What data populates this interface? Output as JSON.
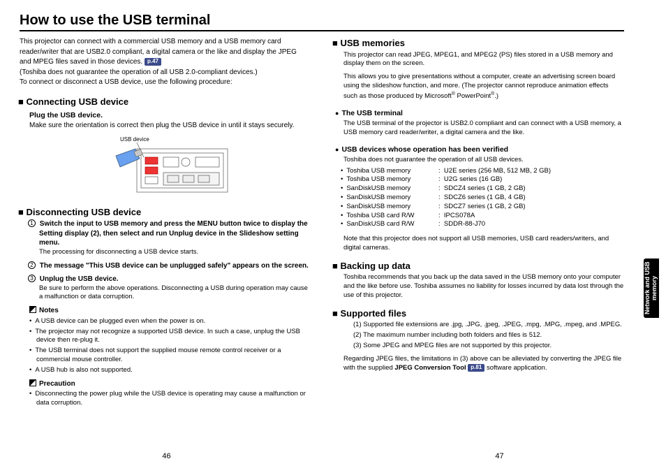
{
  "title": "How to use the USB terminal",
  "intro": {
    "l1": "This projector can connect with a commercial USB memory and a USB memory card",
    "l2": "reader/writer that are USB2.0 compliant, a digital camera or the like and display the JPEG",
    "l3a": "and MPEG files saved in those devices. ",
    "pref1": "p.47",
    "l4": "(Toshiba does not guarantee the operation of all USB 2.0-compliant devices.)",
    "l5": "To connect or disconnect a USB device, use the following procedure:"
  },
  "connecting": {
    "h": "■ Connecting USB device",
    "sub": "Plug the USB device.",
    "txt": "Make sure the orientation is correct then plug the USB device in until it stays securely.",
    "figLabel": "USB device"
  },
  "disconnect": {
    "h": "■ Disconnecting USB device",
    "step1": "Switch the input to USB memory and press the MENU button twice to display the Setting display (2), then select and run Unplug device in the Slideshow setting menu.",
    "step1n": "The processing for disconnecting a USB device starts.",
    "step2": "The message \"This USB device can be unplugged safely\" appears on the screen.",
    "step3": "Unplug the USB device.",
    "step3n": "Be sure to perform the above operations. Disconnecting a USB during operation may cause a malfunction or data corruption."
  },
  "notes": {
    "h": "Notes",
    "i": [
      "A USB device can be plugged even when the power is on.",
      "The projector may not recognize a supported USB device. In such a case, unplug the USB device then re-plug it.",
      "The USB terminal does not support the supplied mouse remote control receiver or a commercial mouse controller.",
      "A USB hub is also not supported."
    ]
  },
  "precaution": {
    "h": "Precaution",
    "i": [
      "Disconnecting the power plug while the USB device is operating may cause a malfunction or data corruption."
    ]
  },
  "usbmem": {
    "h": "■ USB memories",
    "p1": "This projector can read JPEG, MPEG1, and MPEG2 (PS) files stored in a USB memory and display them on the screen.",
    "p2a": "This allows you to give presentations without a computer, create an advertising screen board using the slideshow function, and more. (The projector cannot reproduce animation effects such as those produced by Microsoft",
    "p2b": " PowerPoint",
    "p2c": ".)"
  },
  "usbterm": {
    "h": "The USB terminal",
    "p": "The USB terminal of the projector is USB2.0 compliant and can connect with a USB memory, a USB memory card reader/writer, a digital camera and the like."
  },
  "verified": {
    "h": "USB devices whose operation has been verified",
    "lead": "Toshiba does not guarantee the operation of all USB devices.",
    "rows": [
      [
        "Toshiba USB memory",
        "U2E series (256 MB, 512 MB, 2 GB)"
      ],
      [
        "Toshiba USB memory",
        "U2G series (16 GB)"
      ],
      [
        "SanDiskUSB memory",
        "SDCZ4 series (1 GB, 2 GB)"
      ],
      [
        "SanDiskUSB memory",
        "SDCZ6 series (1 GB, 4 GB)"
      ],
      [
        "SanDiskUSB memory",
        "SDCZ7 series (1 GB, 2 GB)"
      ],
      [
        "Toshiba USB card R/W",
        "IPCS078A"
      ],
      [
        "SanDiskUSB card R/W",
        "SDDR-88-J70"
      ]
    ],
    "note": "Note that this projector does not support all USB memories, USB card readers/writers, and digital cameras."
  },
  "backup": {
    "h": "■ Backing up data",
    "p": "Toshiba recommends that you back up the data saved in the USB memory onto your computer and the like before use. Toshiba assumes no liability for losses incurred by data lost through the use of this projector."
  },
  "supported": {
    "h": "■ Supported files",
    "n1": "(1)  Supported file extensions are .jpg, .JPG, .jpeg, .JPEG, .mpg, .MPG, .mpeg, and .MPEG.",
    "n2": "(2)  The maximum number including both folders and files is 512.",
    "n3": "(3)  Some JPEG and MPEG files are not supported by this projector.",
    "tail1": "Regarding JPEG files, the limitations in (3) above can be alleviated by converting the JPEG file with the supplied ",
    "toolB": "JPEG Conversion Tool",
    "pref2": "p.81",
    "tail2": "  software application."
  },
  "tab": "Network and USB memory",
  "pL": "46",
  "pR": "47"
}
